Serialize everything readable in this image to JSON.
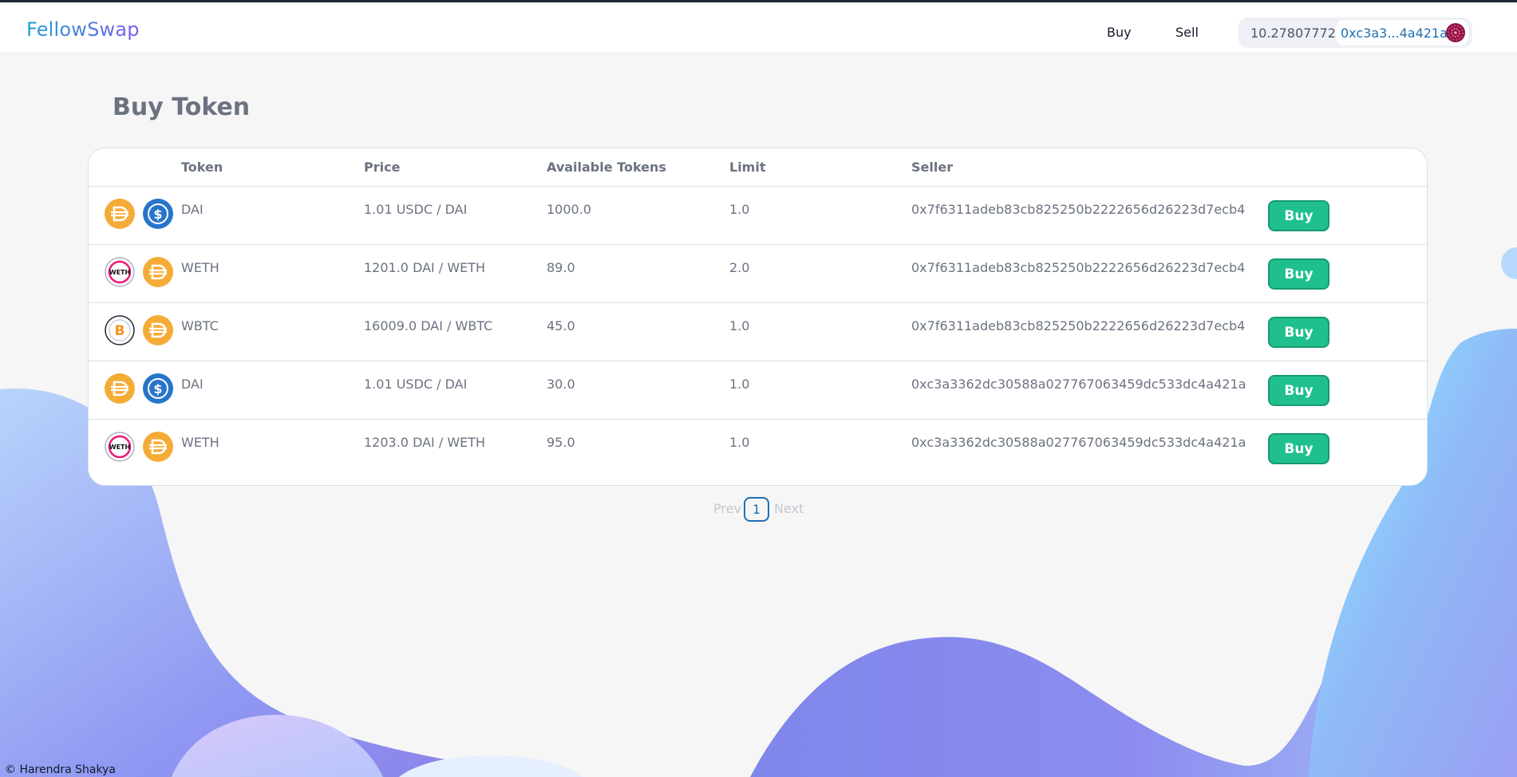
{
  "header": {
    "logo": "FellowSwap",
    "nav": {
      "buy": "Buy",
      "sell": "Sell"
    },
    "wallet": {
      "balance": "10.27807772",
      "address": "0xc3a3...4a421a"
    }
  },
  "page": {
    "title": "Buy Token"
  },
  "table": {
    "columns": {
      "token": "Token",
      "price": "Price",
      "available": "Available Tokens",
      "limit": "Limit",
      "seller": "Seller"
    },
    "rows": [
      {
        "icons": [
          "dai-coin",
          "usdc-coin"
        ],
        "token": "DAI",
        "price": "1.01 USDC / DAI",
        "available": "1000.0",
        "limit": "1.0",
        "seller": "0x7f6311adeb83cb825250b2222656d26223d7ecb4",
        "action": "Buy"
      },
      {
        "icons": [
          "weth-coin",
          "dai-coin"
        ],
        "token": "WETH",
        "price": "1201.0 DAI / WETH",
        "available": "89.0",
        "limit": "2.0",
        "seller": "0x7f6311adeb83cb825250b2222656d26223d7ecb4",
        "action": "Buy"
      },
      {
        "icons": [
          "wbtc-coin",
          "dai-coin"
        ],
        "token": "WBTC",
        "price": "16009.0 DAI / WBTC",
        "available": "45.0",
        "limit": "1.0",
        "seller": "0x7f6311adeb83cb825250b2222656d26223d7ecb4",
        "action": "Buy"
      },
      {
        "icons": [
          "dai-coin",
          "usdc-coin"
        ],
        "token": "DAI",
        "price": "1.01 USDC / DAI",
        "available": "30.0",
        "limit": "1.0",
        "seller": "0xc3a3362dc30588a027767063459dc533dc4a421a",
        "action": "Buy"
      },
      {
        "icons": [
          "weth-coin",
          "dai-coin"
        ],
        "token": "WETH",
        "price": "1203.0 DAI / WETH",
        "available": "95.0",
        "limit": "1.0",
        "seller": "0xc3a3362dc30588a027767063459dc533dc4a421a",
        "action": "Buy"
      }
    ]
  },
  "pagination": {
    "prev": "Prev",
    "current": "1",
    "next": "Next"
  },
  "footer": {
    "text": "© Harendra Shakya"
  },
  "colors": {
    "accent": "#20c08e",
    "link": "#1f6fb2",
    "dai": "#f5ac37",
    "usdc": "#2775ca",
    "weth": "#ec1c79",
    "btc": "#f7931a"
  }
}
